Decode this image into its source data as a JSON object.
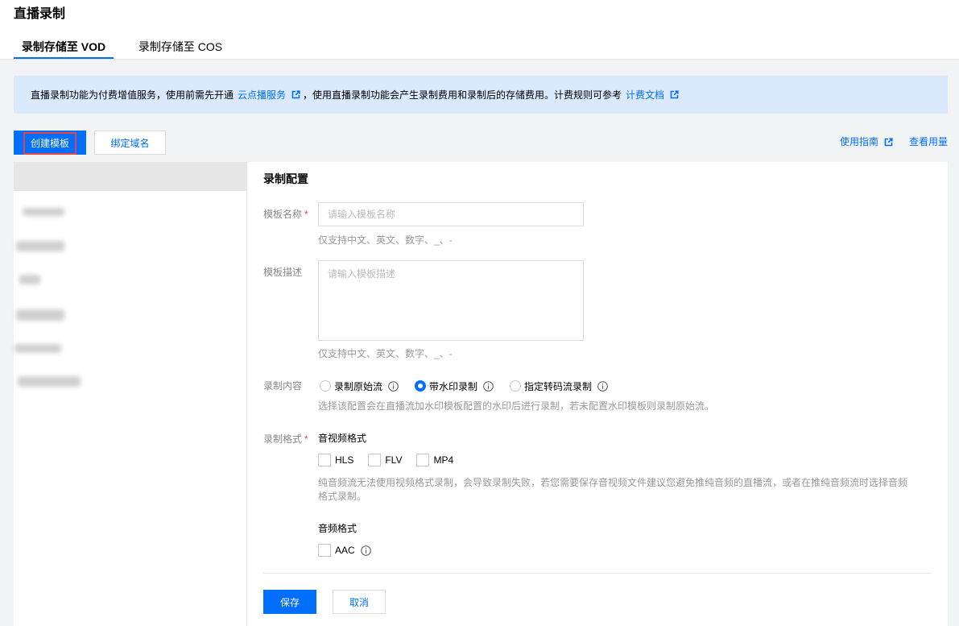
{
  "page": {
    "title": "直播录制"
  },
  "tabs": [
    {
      "label": "录制存储至 VOD",
      "active": true
    },
    {
      "label": "录制存储至 COS",
      "active": false
    }
  ],
  "notice": {
    "text_before": "直播录制功能为付费增值服务，使用前需先开通",
    "link_vod": "云点播服务",
    "text_middle": "，使用直播录制功能会产生录制费用和录制后的存储费用。计费规则可参考",
    "link_billing": "计费文档"
  },
  "toolbar": {
    "create_label": "创建模板",
    "bind_label": "绑定域名",
    "guide_label": "使用指南",
    "usage_label": "查看用量"
  },
  "form": {
    "section_title": "录制配置",
    "required_mark": "*",
    "name": {
      "label": "模板名称",
      "placeholder": "请输入模板名称",
      "value": "",
      "hint": "仅支持中文、英文、数字、_、-"
    },
    "description": {
      "label": "模板描述",
      "placeholder": "请输入模板描述",
      "value": "",
      "hint": "仅支持中文、英文、数字、_、-"
    },
    "content": {
      "label": "录制内容",
      "options": [
        {
          "label": "录制原始流",
          "selected": false
        },
        {
          "label": "带水印录制",
          "selected": true
        },
        {
          "label": "指定转码流录制",
          "selected": false
        }
      ],
      "hint": "选择该配置会在直播流加水印模板配置的水印后进行录制，若未配置水印模板则录制原始流。"
    },
    "format": {
      "label": "录制格式",
      "av_title": "音视频格式",
      "av_options": [
        {
          "label": "HLS",
          "checked": false
        },
        {
          "label": "FLV",
          "checked": false
        },
        {
          "label": "MP4",
          "checked": false
        }
      ],
      "av_hint": "纯音频流无法使用视频格式录制，会导致录制失败，若您需要保存音视频文件建议您避免推纯音频的直播流，或者在推纯音频流时选择音频格式录制。",
      "audio_title": "音频格式",
      "audio_options": [
        {
          "label": "AAC",
          "checked": false
        }
      ]
    },
    "actions": {
      "save_label": "保存",
      "cancel_label": "取消"
    }
  },
  "icons": {
    "external_link": "external-link-icon",
    "info": "info-icon"
  },
  "colors": {
    "accent": "#006eff",
    "highlight": "#e54545",
    "required": "#e54545",
    "notice_bg": "#dbe9fd"
  }
}
